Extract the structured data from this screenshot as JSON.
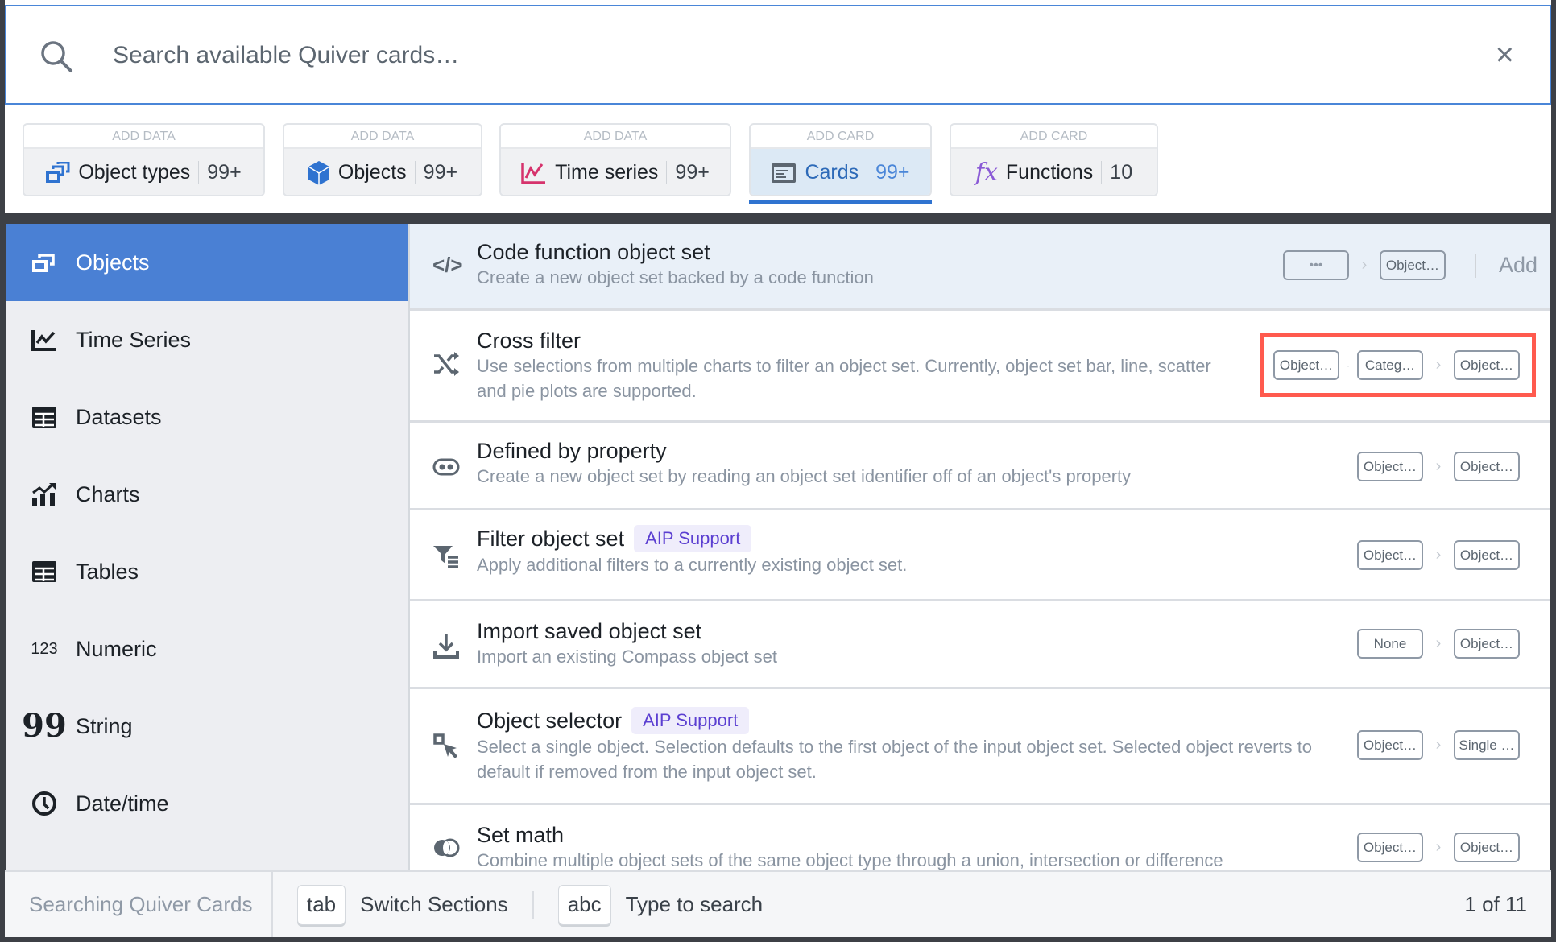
{
  "search": {
    "placeholder": "Search available Quiver cards…",
    "close": "×"
  },
  "tabs": [
    {
      "caption": "ADD DATA",
      "label": "Object types",
      "count": "99+",
      "icon": "object-types-icon"
    },
    {
      "caption": "ADD DATA",
      "label": "Objects",
      "count": "99+",
      "icon": "cube-icon"
    },
    {
      "caption": "ADD DATA",
      "label": "Time series",
      "count": "99+",
      "icon": "timeseries-icon"
    },
    {
      "caption": "ADD CARD",
      "label": "Cards",
      "count": "99+",
      "icon": "card-icon",
      "active": true
    },
    {
      "caption": "ADD CARD",
      "label": "Functions",
      "count": "10",
      "icon": "function-icon"
    }
  ],
  "sidebar": {
    "items": [
      {
        "label": "Objects",
        "icon": "objects-icon",
        "selected": true
      },
      {
        "label": "Time Series",
        "icon": "line-chart-icon"
      },
      {
        "label": "Datasets",
        "icon": "table-icon"
      },
      {
        "label": "Charts",
        "icon": "chart-icon"
      },
      {
        "label": "Tables",
        "icon": "table-icon"
      },
      {
        "label": "Numeric",
        "icon": "numeric-icon",
        "glyph": "123"
      },
      {
        "label": "String",
        "icon": "quote-icon",
        "glyph": "99"
      },
      {
        "label": "Date/time",
        "icon": "clock-icon"
      }
    ]
  },
  "rows": [
    {
      "title": "Code function object set",
      "desc": "Create a new object set backed by a code function",
      "inputs": [
        "•••"
      ],
      "output": "Object…",
      "add": "Add"
    },
    {
      "title": "Cross filter",
      "desc": "Use selections from multiple charts to filter an object set. Currently, object set bar, line, scatter and pie plots are supported.",
      "inputs": [
        "Object…",
        "Categ…"
      ],
      "output": "Object…"
    },
    {
      "title": "Defined by property",
      "desc": "Create a new object set by reading an object set identifier off of an object's property",
      "inputs": [
        "Object…"
      ],
      "output": "Object…"
    },
    {
      "title": "Filter object set",
      "badge": "AIP Support",
      "desc": "Apply additional filters to a currently existing object set.",
      "inputs": [
        "Object…"
      ],
      "output": "Object…"
    },
    {
      "title": "Import saved object set",
      "desc": "Import an existing Compass object set",
      "inputs": [
        "None"
      ],
      "output": "Object…"
    },
    {
      "title": "Object selector",
      "badge": "AIP Support",
      "desc": "Select a single object. Selection defaults to the first object of the input object set. Selected object reverts to default if removed from the input object set.",
      "inputs": [
        "Object…"
      ],
      "output": "Single …"
    },
    {
      "title": "Set math",
      "desc": "Combine multiple object sets of the same object type through a union, intersection or difference",
      "inputs": [
        "Object…"
      ],
      "output": "Object…"
    }
  ],
  "footer": {
    "status": "Searching Quiver Cards",
    "key1": "tab",
    "key1_label": "Switch Sections",
    "key2": "abc",
    "key2_label": "Type to search",
    "page": "1 of 11"
  },
  "colors": {
    "accent": "#4a80d4",
    "highlight": "#ff5a4e",
    "aip": "#5b3fd1"
  }
}
